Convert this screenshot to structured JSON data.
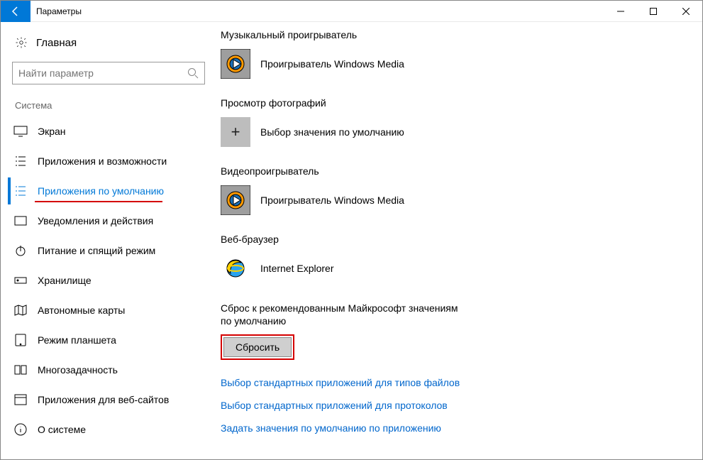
{
  "titlebar": {
    "title": "Параметры"
  },
  "sidebar": {
    "home": "Главная",
    "search_placeholder": "Найти параметр",
    "section": "Система",
    "items": [
      {
        "label": "Экран"
      },
      {
        "label": "Приложения и возможности"
      },
      {
        "label": "Приложения по умолчанию",
        "selected": true
      },
      {
        "label": "Уведомления и действия"
      },
      {
        "label": "Питание и спящий режим"
      },
      {
        "label": "Хранилище"
      },
      {
        "label": "Автономные карты"
      },
      {
        "label": "Режим планшета"
      },
      {
        "label": "Многозадачность"
      },
      {
        "label": "Приложения для веб-сайтов"
      },
      {
        "label": "О системе"
      }
    ]
  },
  "main": {
    "groups": [
      {
        "title": "Музыкальный проигрыватель",
        "app": "Проигрыватель Windows Media",
        "tile": "wmp"
      },
      {
        "title": "Просмотр фотографий",
        "app": "Выбор значения по умолчанию",
        "tile": "plus"
      },
      {
        "title": "Видеопроигрыватель",
        "app": "Проигрыватель Windows Media",
        "tile": "wmp"
      },
      {
        "title": "Веб-браузер",
        "app": "Internet Explorer",
        "tile": "ie"
      }
    ],
    "reset_title": "Сброс к рекомендованным Майкрософт значениям по умолчанию",
    "reset_button": "Сбросить",
    "links": [
      "Выбор стандартных приложений для типов файлов",
      "Выбор стандартных приложений для протоколов",
      "Задать значения по умолчанию по приложению"
    ]
  }
}
